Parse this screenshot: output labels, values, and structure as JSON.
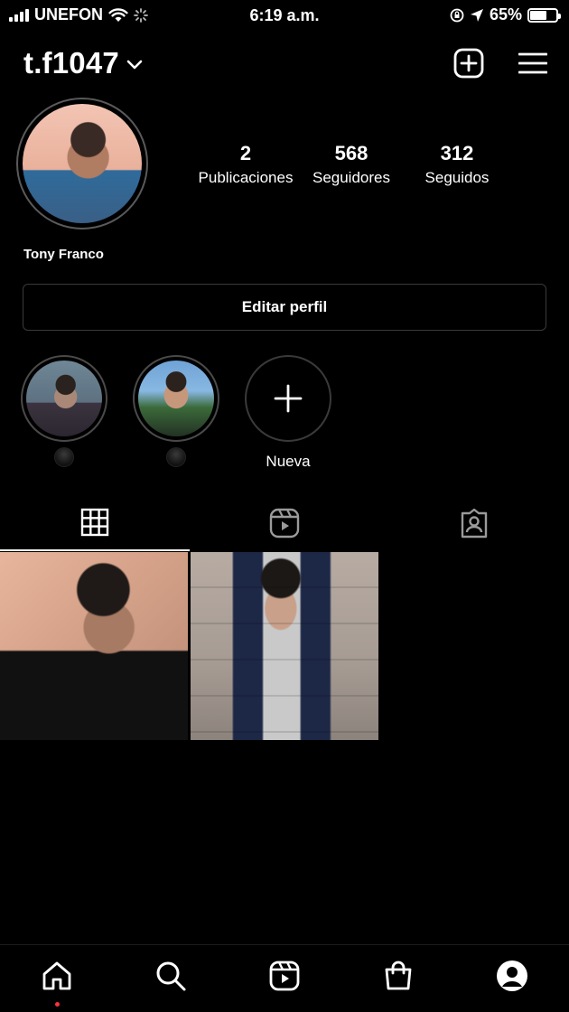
{
  "status_bar": {
    "carrier": "UNEFON",
    "time": "6:19 a.m.",
    "battery": "65%",
    "battery_level": 0.65,
    "signal_bars": 4,
    "icons": [
      "signal-icon",
      "wifi-icon",
      "activity-spinner-icon",
      "screen-lock-rotation-icon",
      "location-arrow-icon",
      "battery-icon"
    ]
  },
  "header": {
    "username": "t.f1047",
    "icons": [
      "chevron-down-icon",
      "new-post-icon",
      "menu-icon"
    ]
  },
  "profile": {
    "full_name": "Tony Franco",
    "stats": [
      {
        "value": "2",
        "label": "Publicaciones"
      },
      {
        "value": "568",
        "label": "Seguidores"
      },
      {
        "value": "312",
        "label": "Seguidos"
      }
    ],
    "edit_button": "Editar perfil"
  },
  "highlights": {
    "items": [
      {
        "title": ""
      },
      {
        "title": ""
      }
    ],
    "new_label": "Nueva",
    "new_icon": "plus-icon"
  },
  "tabs": [
    {
      "icon": "grid-icon",
      "active": true
    },
    {
      "icon": "reels-icon",
      "active": false
    },
    {
      "icon": "tagged-icon",
      "active": false
    }
  ],
  "posts": [
    {
      "description": "photo-1"
    },
    {
      "description": "photo-2"
    }
  ],
  "bottom_nav": [
    {
      "icon": "home-icon",
      "active": true
    },
    {
      "icon": "search-icon",
      "active": false
    },
    {
      "icon": "reels-icon",
      "active": false
    },
    {
      "icon": "shop-icon",
      "active": false
    },
    {
      "icon": "profile-icon",
      "active": false
    }
  ],
  "colors": {
    "background": "#000000",
    "text": "#ffffff",
    "border": "#3a3a3a",
    "notification_dot": "#ff3040"
  }
}
